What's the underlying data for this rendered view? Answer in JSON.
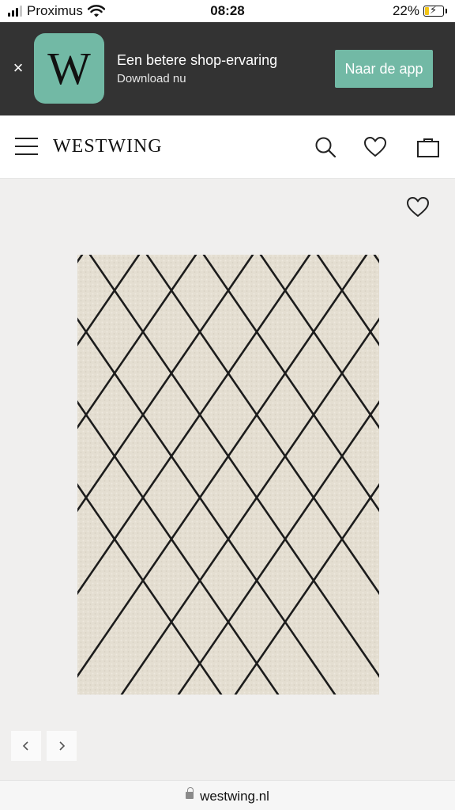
{
  "status_bar": {
    "carrier": "Proximus",
    "time": "08:28",
    "battery_percent": "22%"
  },
  "app_banner": {
    "logo_letter": "W",
    "title": "Een betere shop-ervaring",
    "subtitle": "Download nu",
    "cta_label": "Naar de app",
    "accent_color": "#72b9a5",
    "background_color": "#333333"
  },
  "header": {
    "brand": "WESTWING",
    "icons": [
      "menu-icon",
      "search-icon",
      "heart-icon",
      "bag-icon"
    ]
  },
  "product": {
    "image": "rug-beige-black-diamond-pattern",
    "wishlist_icon": "heart-outline-icon",
    "carousel": {
      "prev_icon": "chevron-left-icon",
      "next_icon": "chevron-right-icon"
    }
  },
  "browser": {
    "url": "westwing.nl"
  }
}
